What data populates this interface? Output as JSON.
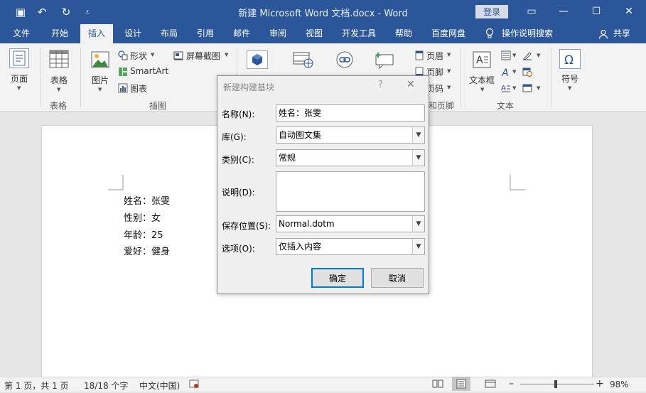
{
  "titlebar": {
    "doc_title": "新建 Microsoft Word 文档.docx  -  Word",
    "login": "登录",
    "save_glyph": "▣",
    "undo_glyph": "↶",
    "redo_glyph": "↻",
    "customize_glyph": "⩡",
    "ribbon_opts_glyph": "▭",
    "min_glyph": "—",
    "max_glyph": "☐",
    "close_glyph": "✕"
  },
  "menu": {
    "tabs": [
      "文件",
      "开始",
      "插入",
      "设计",
      "布局",
      "引用",
      "邮件",
      "审阅",
      "视图",
      "开发工具",
      "帮助",
      "百度网盘"
    ],
    "active_tab": "插入",
    "search": "操作说明搜索",
    "share": "共享"
  },
  "ribbon": {
    "pages": "页面",
    "table": "表格",
    "picture": "图片",
    "shapes": "形状",
    "smartart": "SmartArt",
    "chart": "图表",
    "screenshot": "屏幕截图",
    "header": "页眉",
    "footer": "页脚",
    "page_number": "页码",
    "textbox": "文本框",
    "symbol": "符号",
    "group_table": "表格",
    "group_illustrations": "插图",
    "group_header_footer": "和页脚",
    "group_text": "文本"
  },
  "document": {
    "lines": [
      "姓名：张雯",
      "性别：女",
      "年龄：25",
      "爱好：健身"
    ]
  },
  "dialog": {
    "title": "新建构建基块",
    "help": "?",
    "close": "✕",
    "name_label": "名称(N):",
    "name_value": "姓名：张雯",
    "gallery_label": "库(G):",
    "gallery_value": "自动图文集",
    "category_label": "类别(C):",
    "category_value": "常规",
    "desc_label": "说明(D):",
    "desc_value": "",
    "save_label": "保存位置(S):",
    "save_value": "Normal.dotm",
    "options_label": "选项(O):",
    "options_value": "仅插入内容",
    "ok": "确定",
    "cancel": "取消"
  },
  "statusbar": {
    "page": "第 1 页，共 1 页",
    "words": "18/18 个字",
    "language": "中文(中国)",
    "zoom": "98%",
    "zoom_level": 0.98
  },
  "colors": {
    "brand": "#2b579a",
    "ok_border": "#0078d7"
  }
}
